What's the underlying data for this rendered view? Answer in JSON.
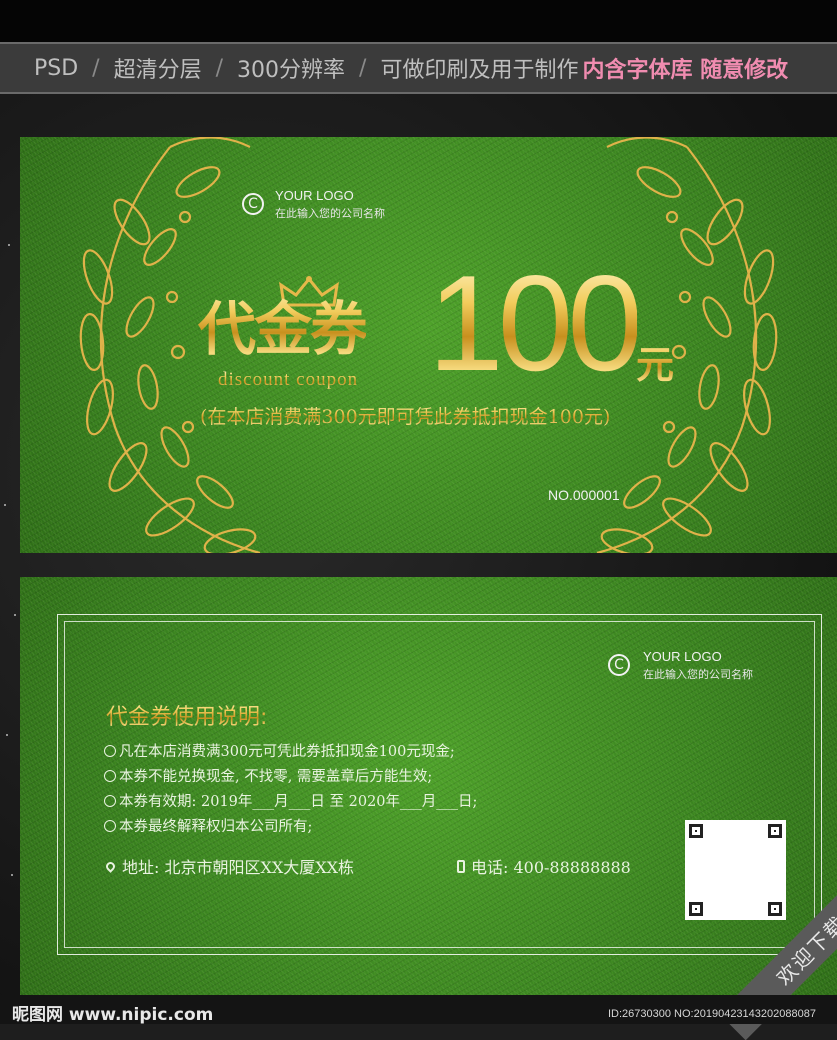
{
  "banner": {
    "items": [
      "PSD",
      "超清分层",
      "300分辨率",
      "可做印刷及用于制作"
    ],
    "highlight": "内含字体库 随意修改"
  },
  "front": {
    "logo_mark": "C",
    "logo_name": "YOUR LOGO",
    "logo_sub": "在此输入您的公司名称",
    "title_cn": "代金券",
    "title_en": "discount coupon",
    "amount": "100",
    "currency": "元",
    "condition": "(在本店消费满300元即可凭此券抵扣现金100元)",
    "serial": "NO.000001"
  },
  "back": {
    "logo_mark": "C",
    "logo_name": "YOUR LOGO",
    "logo_sub": "在此输入您的公司名称",
    "instructions_title": "代金券使用说明:",
    "rules": [
      "凡在本店消费满300元可凭此券抵扣现金100元现金;",
      "本券不能兑换现金, 不找零, 需要盖章后方能生效;",
      "本券有效期: 2019年___月___日 至 2020年___月___日;",
      "本券最终解释权归本公司所有;"
    ],
    "address": "地址: 北京市朝阳区XX大厦XX栋",
    "phone": "电话: 400-88888888"
  },
  "corner_badge": "欢迎下载",
  "watermark": {
    "site": "昵图网 www.nipic.com",
    "id": "ID:26730300 NO:20190423143202088087"
  },
  "colors": {
    "grass": "#3f8a22",
    "gold": "#e6b84a",
    "banner_bg": "#3b3b3b",
    "highlight": "#f08cb0"
  }
}
